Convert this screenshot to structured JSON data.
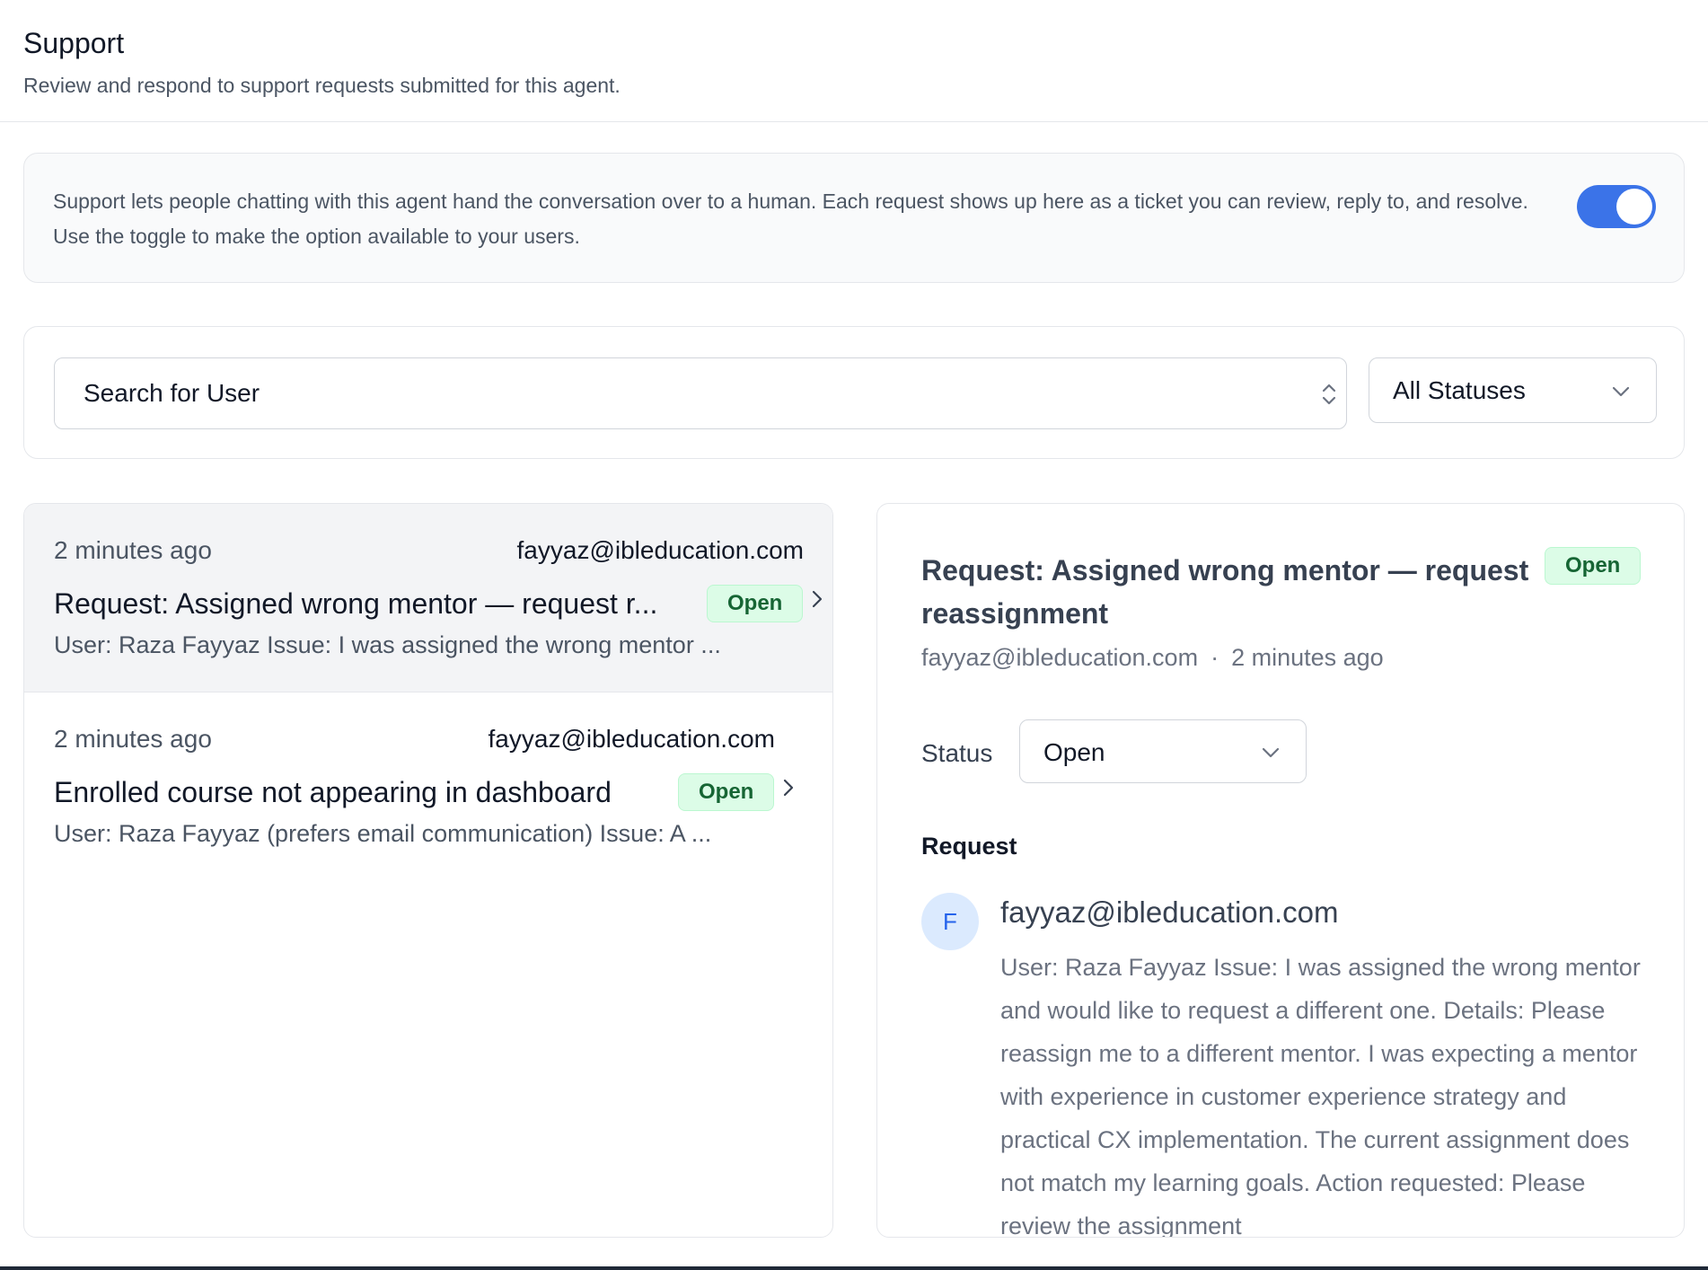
{
  "header": {
    "title": "Support",
    "subtitle": "Review and respond to support requests submitted for this agent."
  },
  "info": {
    "text": "Support lets people chatting with this agent hand the conversation over to a human. Each request shows up here as a ticket you can review, reply to, and resolve. Use the toggle to make the option available to your users.",
    "toggle_on": true,
    "toggle_color": "#3b73e8"
  },
  "filters": {
    "search_placeholder": "Search for User",
    "status_selected": "All Statuses"
  },
  "tickets": [
    {
      "time": "2 minutes ago",
      "email": "fayyaz@ibleducation.com",
      "title": "Request: Assigned wrong mentor — request r...",
      "status": "Open",
      "preview": "User: Raza Fayyaz Issue: I was assigned the wrong mentor ..."
    },
    {
      "time": "2 minutes ago",
      "email": "fayyaz@ibleducation.com",
      "title": "Enrolled course not appearing in dashboard",
      "status": "Open",
      "preview": "User: Raza Fayyaz (prefers email communication) Issue: A ..."
    }
  ],
  "detail": {
    "title": "Request: Assigned wrong mentor — request reassignment",
    "status_badge": "Open",
    "email": "fayyaz@ibleducation.com",
    "time": "2 minutes ago",
    "meta_separator": "·",
    "status_label": "Status",
    "status_value": "Open",
    "request_heading": "Request",
    "message": {
      "avatar_initial": "F",
      "email": "fayyaz@ibleducation.com",
      "body": "User: Raza Fayyaz Issue: I was assigned the wrong mentor and would like to request a different one. Details: Please reassign me to a different mentor. I was expecting a mentor with experience in customer experience strategy and practical CX implementation. The current assignment does not match my learning goals. Action requested: Please review the assignment"
    }
  },
  "colors": {
    "badge_bg": "#dcfce7",
    "badge_text": "#166534",
    "avatar_bg": "#dbeafe",
    "avatar_text": "#2563eb"
  }
}
